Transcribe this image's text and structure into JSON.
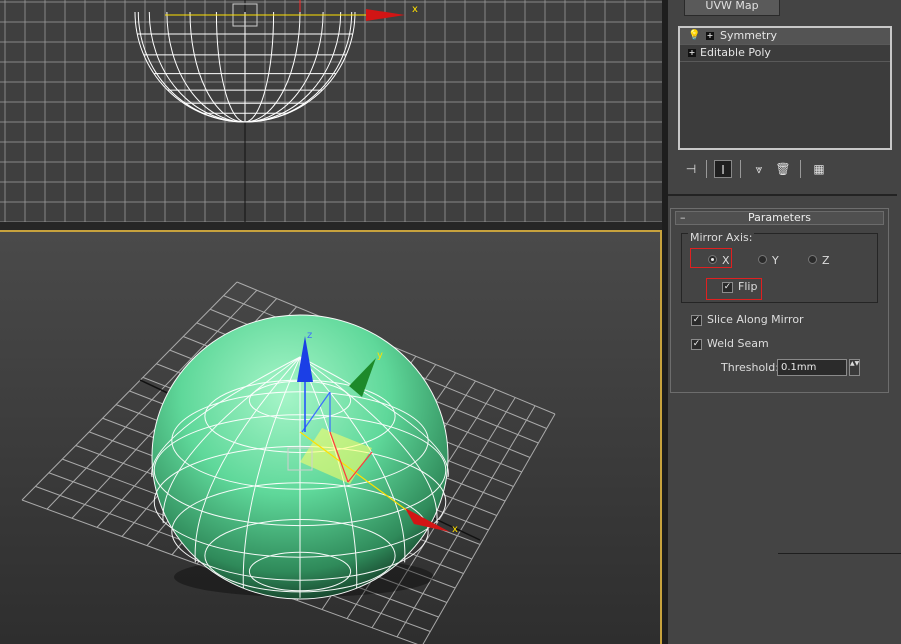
{
  "modifier_stack": {
    "top_button_label": "UVW Map",
    "items": [
      {
        "label": "Symmetry",
        "plus": "+",
        "bulb": "💡"
      },
      {
        "label": "Editable Poly",
        "plus": "+"
      }
    ]
  },
  "toolbar": {
    "icons": [
      "pin-stack-icon",
      "show-end-result-icon",
      "make-unique-icon",
      "remove-modifier-icon",
      "configure-sets-icon"
    ],
    "glyphs": {
      "pin": "⊣",
      "end_result": "I",
      "unique": "⩔",
      "remove": "🗑",
      "configure": "▦"
    }
  },
  "parameters": {
    "rollout_title": "Parameters",
    "rollout_toggle": "–",
    "mirror_axis_label": "Mirror Axis:",
    "axes": [
      {
        "label": "X",
        "selected": true
      },
      {
        "label": "Y",
        "selected": false
      },
      {
        "label": "Z",
        "selected": false
      }
    ],
    "flip": {
      "label": "Flip",
      "checked": true,
      "mark": "✓"
    },
    "slice_along_mirror": {
      "label": "Slice Along Mirror",
      "checked": true,
      "mark": "✓"
    },
    "weld_seam": {
      "label": "Weld Seam",
      "checked": true,
      "mark": "✓"
    },
    "threshold": {
      "label": "Threshold:",
      "value": "0.1mm",
      "spin": "▲▼"
    }
  },
  "viewports": {
    "top_axis_label": "x",
    "persp_axis_labels": {
      "x": "x",
      "y": "y",
      "z": "z"
    },
    "sphere_color": "#5fd89a",
    "grid_color": "#9a9a9a",
    "highlight_color": "#e02020",
    "active_border_color": "#c7a23d"
  }
}
